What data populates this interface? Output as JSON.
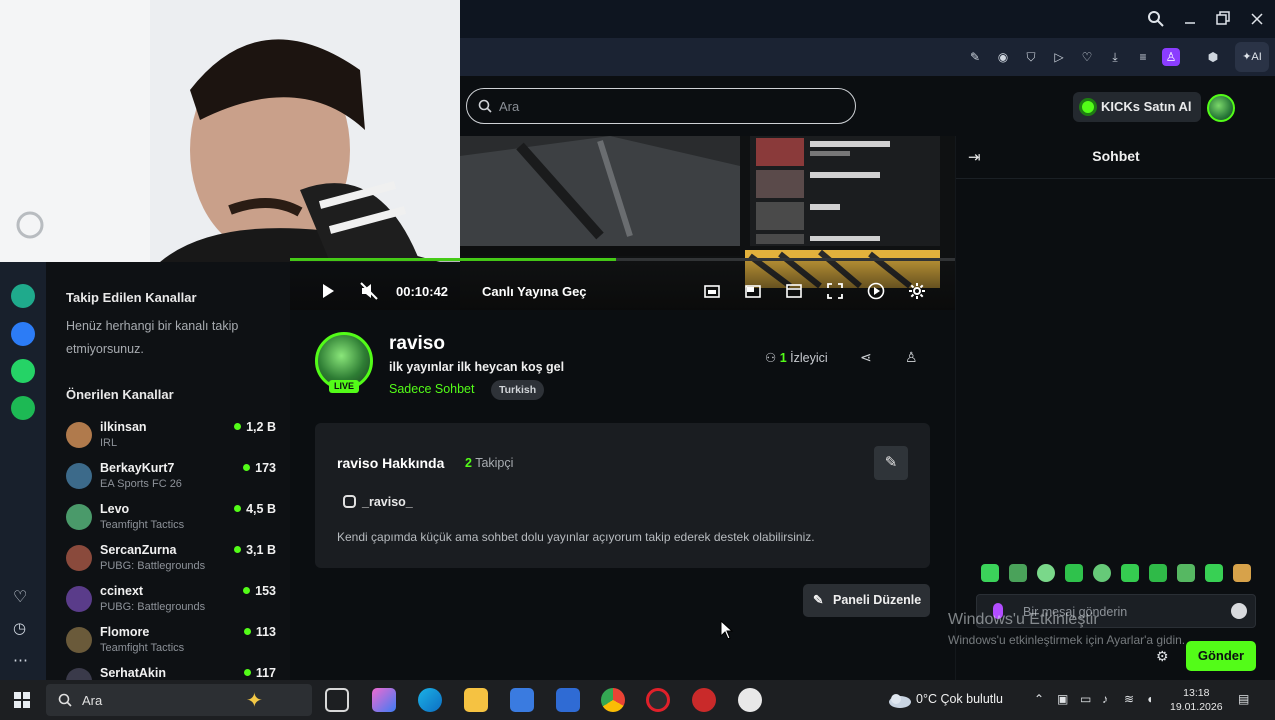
{
  "browser": {
    "window_controls": [
      "search",
      "minimize",
      "restore",
      "close"
    ],
    "ai_label": "AI"
  },
  "kick_header": {
    "search_placeholder": "Ara",
    "kicks_button": "KICKs Satın Al"
  },
  "player": {
    "time": "00:10:42",
    "go_live": "Canlı Yayına Geç",
    "progress_fraction": 0.49
  },
  "sidebar": {
    "following_title": "Takip Edilen Kanallar",
    "following_empty": "Henüz herhangi bir kanalı takip etmiyorsunuz.",
    "recommended_title": "Önerilen Kanallar",
    "channels": [
      {
        "name": "ilkinsan",
        "category": "IRL",
        "viewers": "1,2 B",
        "color": "#b07a4c"
      },
      {
        "name": "BerkayKurt7",
        "category": "EA Sports FC 26",
        "viewers": "173",
        "color": "#3c6a8a"
      },
      {
        "name": "Levo",
        "category": "Teamfight Tactics",
        "viewers": "4,5 B",
        "color": "#4a9a6a"
      },
      {
        "name": "SercanZurna",
        "category": "PUBG: Battlegrounds",
        "viewers": "3,1 B",
        "color": "#8a4a3c"
      },
      {
        "name": "ccinext",
        "category": "PUBG: Battlegrounds",
        "viewers": "153",
        "color": "#5a3c8a"
      },
      {
        "name": "Flomore",
        "category": "Teamfight Tactics",
        "viewers": "113",
        "color": "#6a5a3a"
      },
      {
        "name": "SerhatAkin",
        "category": "",
        "viewers": "117",
        "color": "#3a3a4a"
      }
    ]
  },
  "channel": {
    "name": "raviso",
    "stream_title": "ilk yayınlar ilk heycan koş gel",
    "category": "Sadece Sohbet",
    "tag": "Turkish",
    "live_badge": "LIVE",
    "viewer_count": "1",
    "viewer_label": "İzleyici"
  },
  "about": {
    "title": "raviso Hakkında",
    "follower_count": "2",
    "follower_label": "Takipçi",
    "instagram": "_raviso_",
    "description": "Kendi çapımda küçük ama sohbet dolu yayınlar açıyorum takip ederek destek olabilirsiniz.",
    "edit_panels": "Paneli Düzenle"
  },
  "chat": {
    "title": "Sohbet",
    "placeholder": "Bir mesaj gönderin",
    "send": "Gönder",
    "watermark_title": "Windows'u Etkinleştir",
    "watermark_sub": "Windows'u etkinleştirmek için Ayarlar'a gidin."
  },
  "taskbar": {
    "search_placeholder": "Ara",
    "weather": "0°C  Çok bulutlu",
    "time": "13:18",
    "date": "19.01.2026"
  }
}
